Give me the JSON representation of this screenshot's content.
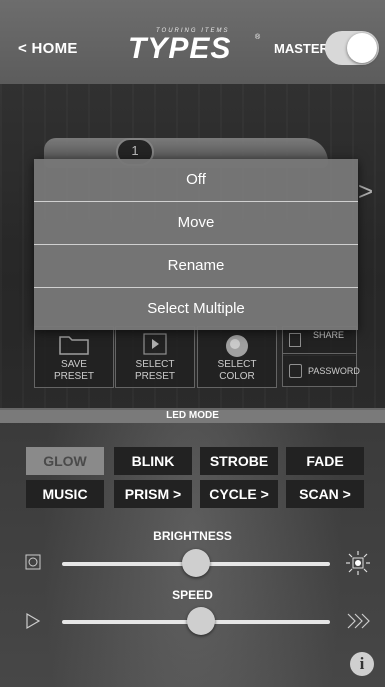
{
  "header": {
    "home_label": "< HOME",
    "brand_small": "TOURING ITEMS",
    "brand_name": "TYPES",
    "brand_reg": "®",
    "master_label": "MASTER",
    "master_on": true
  },
  "scene": {
    "zone_number": "1",
    "next_icon": "chevron-right-icon"
  },
  "actions": [
    {
      "label_line1": "SAVE",
      "label_line2": "PRESET",
      "icon": "folder-icon"
    },
    {
      "label_line1": "SELECT",
      "label_line2": "PRESET",
      "icon": "play-icon"
    },
    {
      "label_line1": "SELECT",
      "label_line2": "COLOR",
      "icon": "color-wheel-icon"
    }
  ],
  "side_actions": {
    "share_label": "SHARE",
    "password_label": "PASSWORD"
  },
  "led_mode": {
    "title": "LED MODE",
    "modes": [
      "GLOW",
      "BLINK",
      "STROBE",
      "FADE",
      "MUSIC",
      "PRISM >",
      "CYCLE >",
      "SCAN >"
    ],
    "active_mode": "GLOW"
  },
  "brightness": {
    "label": "BRIGHTNESS",
    "value_fraction": 0.5
  },
  "speed": {
    "label": "SPEED",
    "value_fraction": 0.52
  },
  "context_menu": {
    "items": [
      "Off",
      "Move",
      "Rename",
      "Select Multiple"
    ]
  },
  "colors": {
    "header_bg": "#5c5c5c",
    "menu_bg": "#787878",
    "active_mode_bg": "#8a8a8a"
  }
}
